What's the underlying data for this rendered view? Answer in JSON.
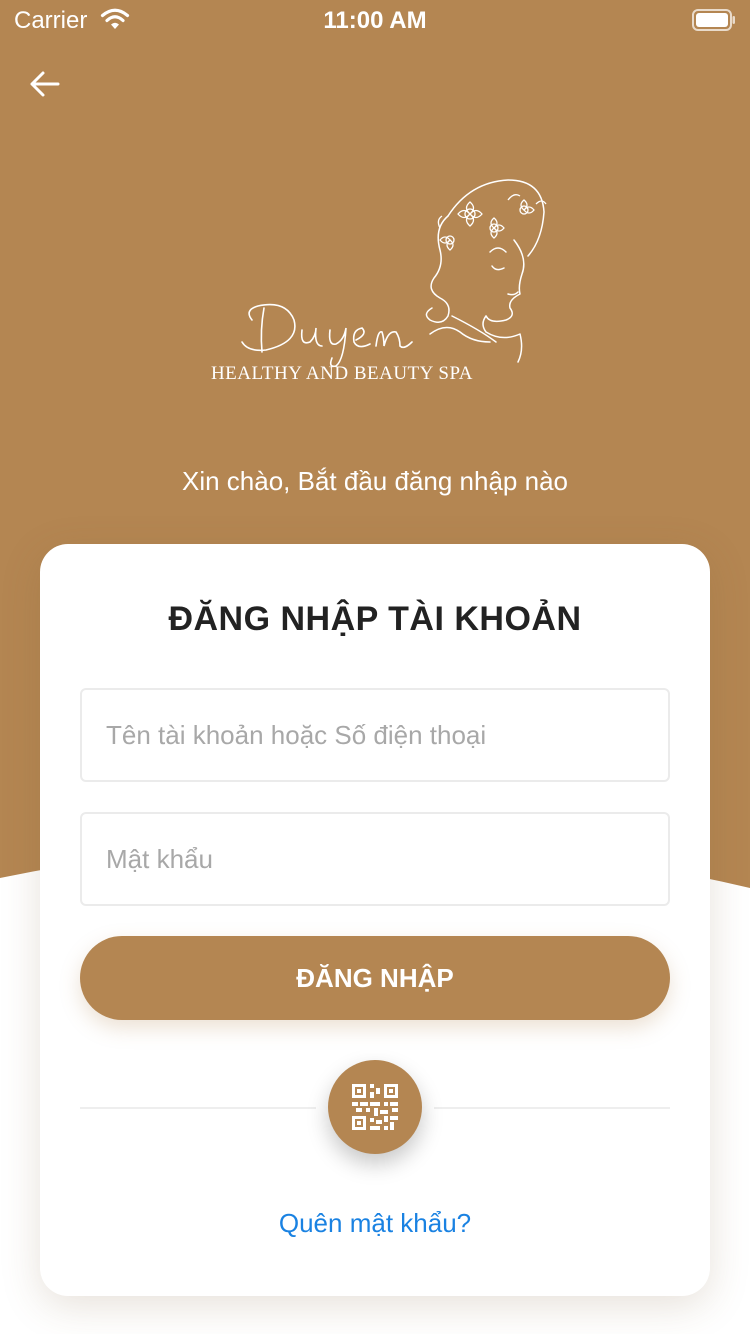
{
  "status_bar": {
    "carrier": "Carrier",
    "time": "11:00 AM"
  },
  "icons": {
    "wifi": "wifi-icon",
    "battery": "battery-icon",
    "back": "back-arrow-icon",
    "qr": "qr-code-icon"
  },
  "logo": {
    "brand": "Duyen",
    "tagline": "HEALTHY AND BEAUTY SPA"
  },
  "greeting": "Xin chào, Bắt đầu đăng nhập nào",
  "login_card": {
    "title": "ĐĂNG NHẬP TÀI KHOẢN",
    "username": {
      "value": "",
      "placeholder": "Tên tài khoản hoặc Số điện thoại"
    },
    "password": {
      "value": "",
      "placeholder": "Mật khẩu"
    },
    "login_button_label": "ĐĂNG NHẬP",
    "forgot_password_label": "Quên mật khẩu?"
  },
  "colors": {
    "brand": "#b48652",
    "link": "#1a82e2",
    "title": "#222222",
    "placeholder": "#a8a8a8"
  }
}
